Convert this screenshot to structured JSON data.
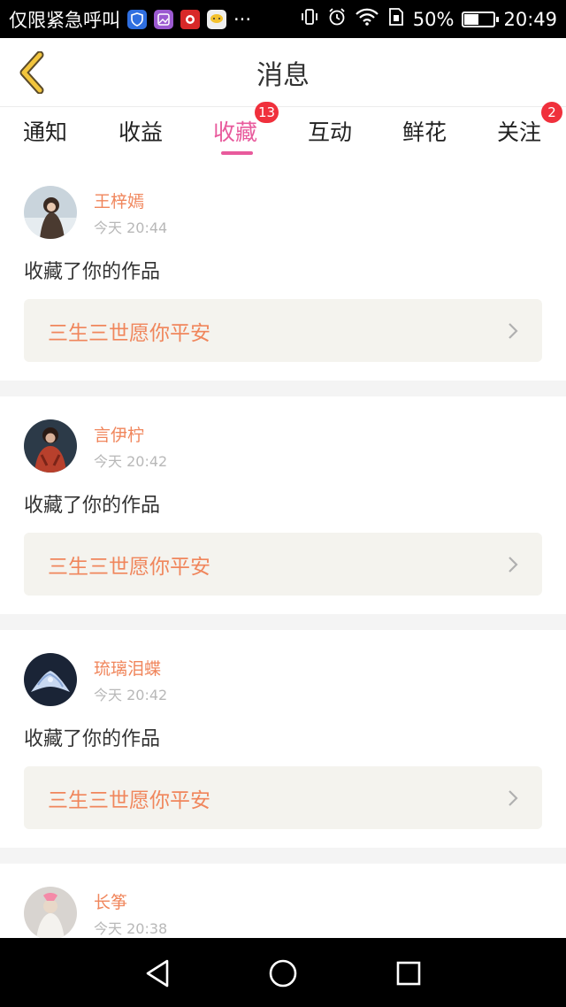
{
  "status_bar": {
    "carrier": "仅限紧急呼叫",
    "more": "···",
    "battery": "50%",
    "battery_level": 0.5,
    "time": "20:49",
    "icons": [
      "shield-app-icon",
      "gallery-app-icon",
      "news-app-icon",
      "chat-app-icon",
      "vibrate-icon",
      "alarm-icon",
      "wifi-icon",
      "sim-icon",
      "battery-icon"
    ]
  },
  "header": {
    "title": "消息",
    "back_icon": "chevron-left-icon"
  },
  "tabs": [
    {
      "label": "通知",
      "badge": ""
    },
    {
      "label": "收益",
      "badge": ""
    },
    {
      "label": "收藏",
      "badge": "13",
      "active": true
    },
    {
      "label": "互动",
      "badge": ""
    },
    {
      "label": "鲜花",
      "badge": ""
    },
    {
      "label": "关注",
      "badge": "2"
    }
  ],
  "messages": [
    {
      "user": "王梓嫣",
      "time": "今天 20:44",
      "action": "收藏了你的作品",
      "work": "三生三世愿你平安"
    },
    {
      "user": "言伊柠",
      "time": "今天 20:42",
      "action": "收藏了你的作品",
      "work": "三生三世愿你平安"
    },
    {
      "user": "琉璃泪蝶",
      "time": "今天 20:42",
      "action": "收藏了你的作品",
      "work": "三生三世愿你平安"
    },
    {
      "user": "长筝",
      "time": "今天 20:38",
      "action": "",
      "work": ""
    }
  ],
  "colors": {
    "accent_pink": "#e85a9c",
    "name_orange": "#f0865c",
    "badge_red": "#f0303c",
    "back_yellow": "#f2c53d"
  },
  "navbar": {
    "icons": [
      "back-triangle-icon",
      "home-circle-icon",
      "recents-square-icon"
    ]
  }
}
